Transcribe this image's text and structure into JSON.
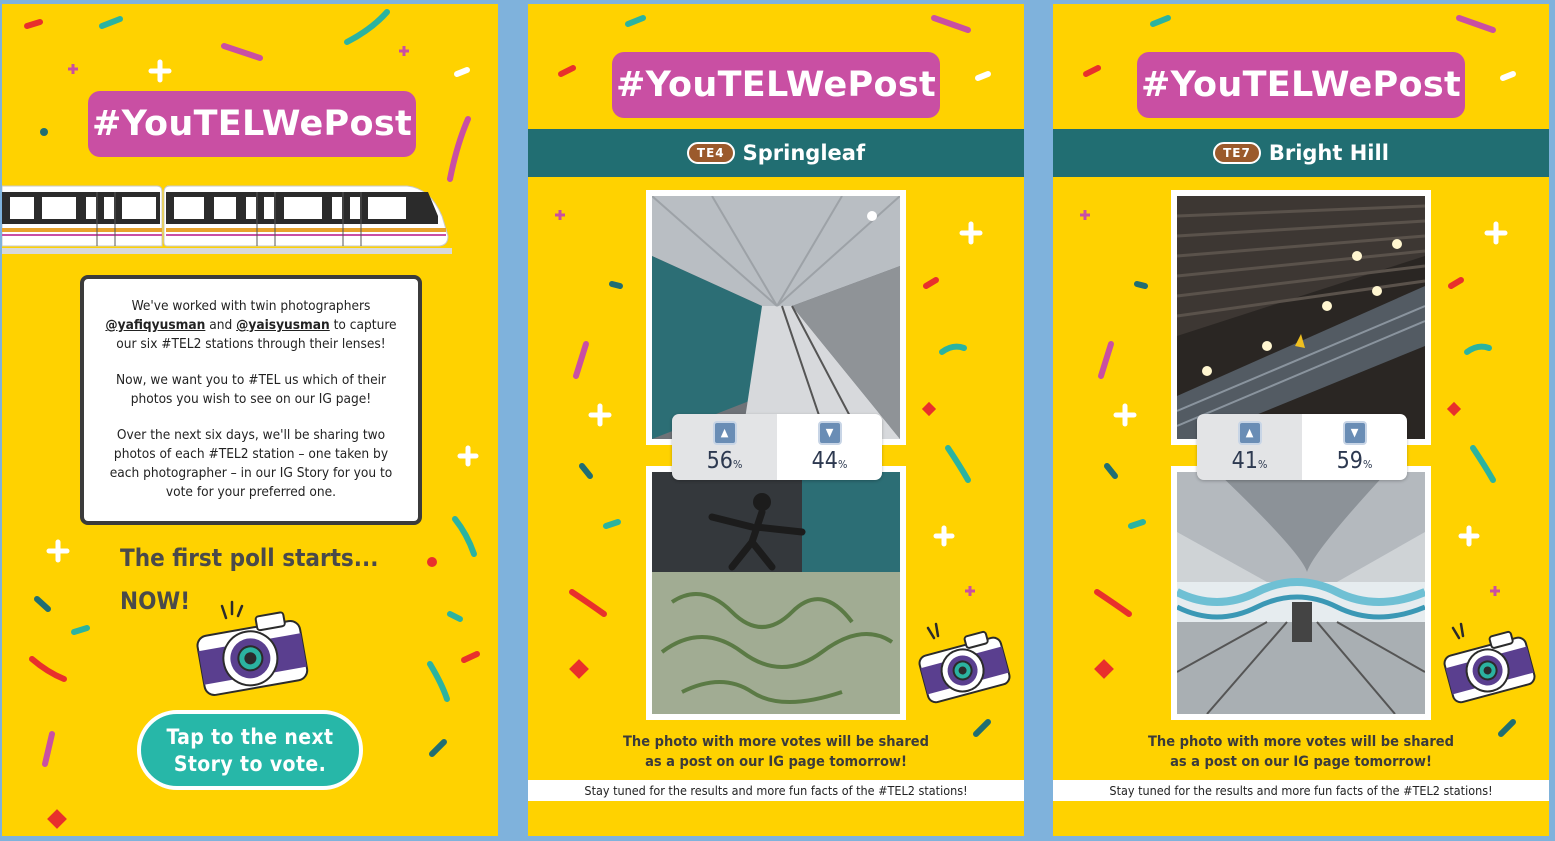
{
  "colors": {
    "background": "#ffd200",
    "hashtag": "#c94fa3",
    "banner": "#216e72",
    "button": "#27b7a8",
    "frame": "#7fb2dc"
  },
  "panel1": {
    "hashtag": "#YouTELWePost",
    "intro_part1": "We've worked with twin photographers",
    "handle1": "@yafiqyusman",
    "and_word": "and",
    "handle2": "@yaisyusman",
    "intro_part2": "to capture our six #TEL2 stations through their lenses!",
    "para2": "Now, we want you to #TEL us which of their photos you wish to see on our IG page!",
    "para3": "Over the next six days, we'll be sharing two photos of each #TEL2 station – one taken by each photographer – in our IG Story for you to vote for your preferred one.",
    "poll_line1": "The first poll starts...",
    "poll_line2": "NOW!",
    "button_line1": "Tap to the next",
    "button_line2": "Story to vote.",
    "train_icon": "train-icon",
    "camera_icon": "camera-icon"
  },
  "panel2": {
    "hashtag": "#YouTELWePost",
    "station_code": "TE4",
    "station_name": "Springleaf",
    "vote_up_percent": "56",
    "vote_down_percent": "44",
    "caption_line1": "The photo with more votes will be shared",
    "caption_line2": "as a post on our IG page tomorrow!",
    "footer": "Stay tuned for the results and more fun facts of the #TEL2 stations!"
  },
  "panel3": {
    "hashtag": "#YouTELWePost",
    "station_code": "TE7",
    "station_name": "Bright Hill",
    "vote_up_percent": "41",
    "vote_down_percent": "59",
    "caption_line1": "The photo with more votes will be shared",
    "caption_line2": "as a post on our IG page tomorrow!",
    "footer": "Stay tuned for the results and more fun facts of the #TEL2 stations!"
  },
  "percent_sign": "%"
}
